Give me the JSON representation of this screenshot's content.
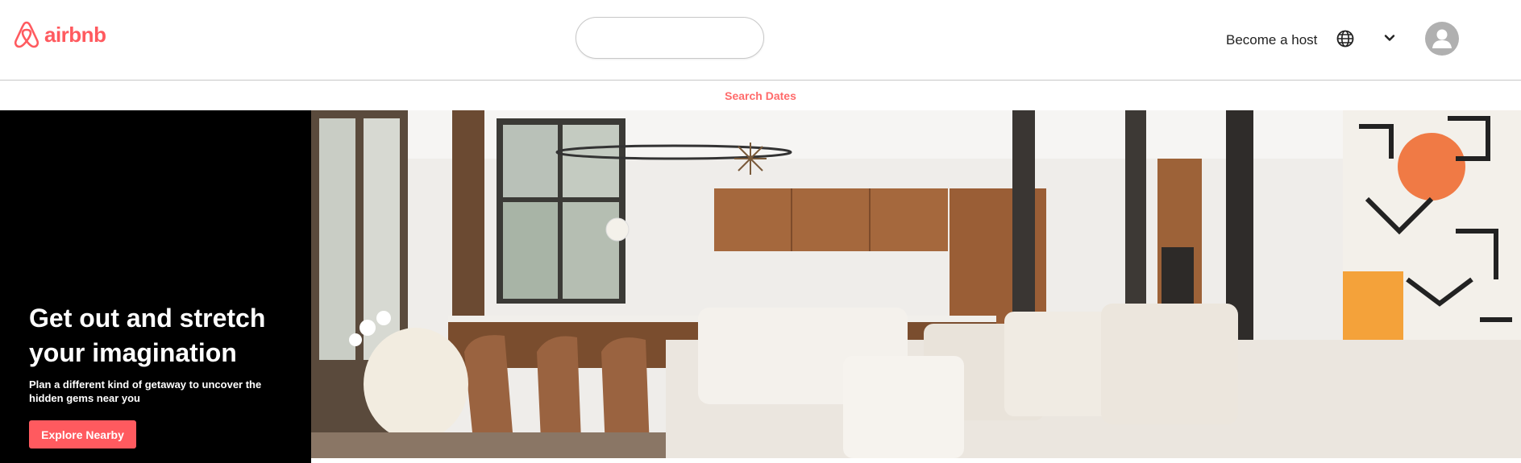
{
  "header": {
    "logo_text": "airbnb",
    "search": {
      "value": "",
      "placeholder": ""
    },
    "become_host": "Become a host"
  },
  "dates_bar": {
    "search_dates": "Search Dates"
  },
  "hero": {
    "title": "Get out and stretch your imagination",
    "subtitle": "Plan a different kind of getaway to uncover the hidden gems near you",
    "button": "Explore Nearby"
  },
  "colors": {
    "brand": "#FF5A5F",
    "hero_panel": "#000000"
  },
  "icons": [
    "airbnb-logo-icon",
    "search-icon",
    "globe-icon",
    "chevron-down-icon",
    "user-avatar-icon"
  ]
}
